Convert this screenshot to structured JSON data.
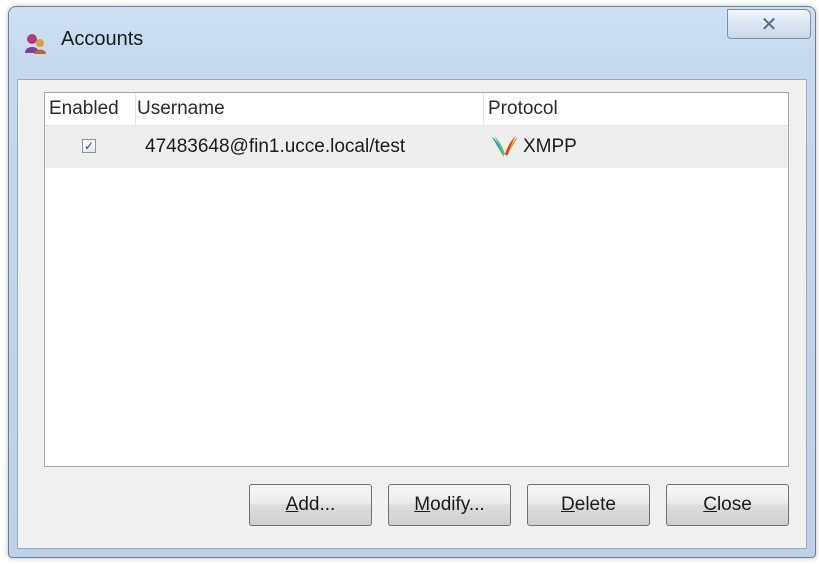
{
  "window": {
    "title": "Accounts",
    "close_glyph": "✕",
    "app_icon": "accounts-app-icon"
  },
  "list": {
    "columns": [
      "Enabled",
      "Username",
      "Protocol"
    ],
    "rows": [
      {
        "enabled": true,
        "check_glyph": "✓",
        "username": "47483648@fin1.ucce.local/test",
        "protocol": "XMPP",
        "protocol_icon": "xmpp-icon"
      }
    ]
  },
  "buttons": {
    "add": {
      "mnemonic": "A",
      "rest": "dd..."
    },
    "modify": {
      "mnemonic": "M",
      "rest": "odify..."
    },
    "delete": {
      "mnemonic": "D",
      "rest": "elete"
    },
    "close": {
      "mnemonic": "C",
      "rest": "lose"
    }
  },
  "colors": {
    "titlebar": "#c4d8ee",
    "selected_row": "#eeeeee",
    "checkmark": "#2b3f9a"
  }
}
